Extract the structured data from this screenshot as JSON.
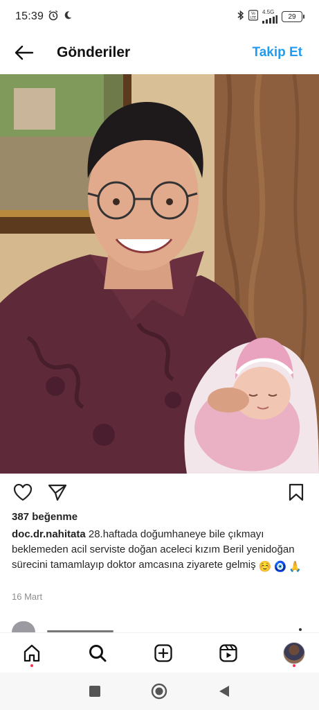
{
  "status": {
    "time": "15:39",
    "network": "4.5G",
    "volte": "Vo LTE",
    "battery": "29"
  },
  "header": {
    "title": "Gönderiler",
    "follow_label": "Takip Et"
  },
  "post": {
    "likes": "387 beğenme",
    "username": "doc.dr.nahitata",
    "caption": "28.haftada doğumhaneye bile çıkmayı beklemeden acil serviste doğan aceleci kızım Beril yenidoğan sürecini tamamlayıp doktor amcasına ziyarete gelmiş",
    "emojis": [
      "☺️",
      "🧿",
      "🙏"
    ],
    "date": "16 Mart"
  },
  "colors": {
    "accent": "#1f9cf0",
    "notification_dot": "#ff2e54"
  },
  "icons": {
    "status_left": [
      "alarm-icon",
      "moon-icon"
    ],
    "status_right": [
      "bluetooth-icon",
      "volte-icon",
      "signal-icon",
      "battery-icon"
    ],
    "actions": [
      "heart-icon",
      "send-icon",
      "bookmark-icon"
    ],
    "nav": [
      "home-icon",
      "search-icon",
      "create-icon",
      "reels-icon",
      "profile-avatar"
    ],
    "system": [
      "recents-icon",
      "home-circle-icon",
      "back-triangle-icon"
    ]
  }
}
